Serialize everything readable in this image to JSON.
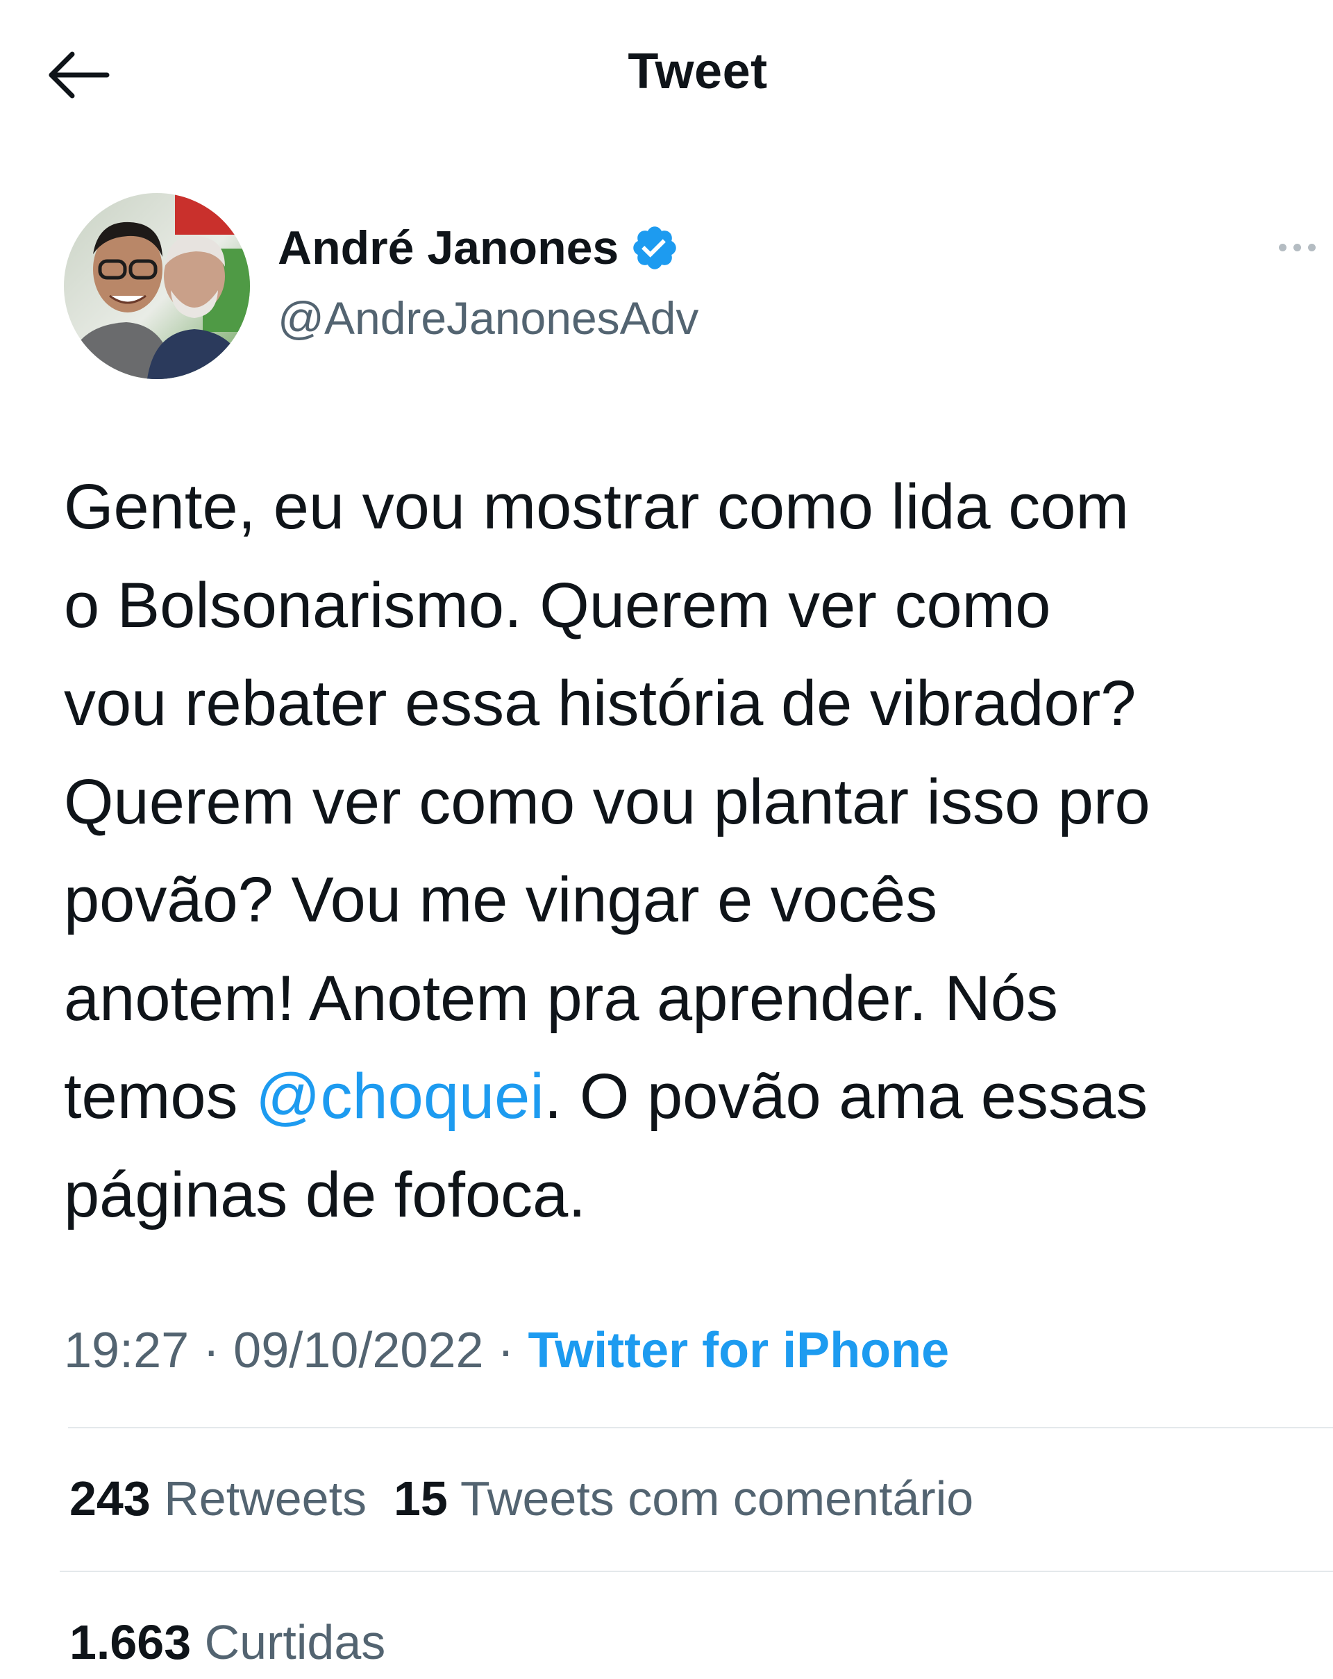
{
  "header": {
    "title": "Tweet"
  },
  "author": {
    "name": "André Janones",
    "handle": "@AndreJanonesAdv"
  },
  "tweet": {
    "lines": [
      "Gente, eu vou mostrar como lida com",
      "o Bolsonarismo. Querem ver como",
      "vou rebater essa história de vibrador?",
      "Querem ver como vou plantar isso pro",
      "povão? Vou me vingar e vocês",
      "anotem! Anotem pra aprender. Nós"
    ],
    "line7_prefix": "temos ",
    "mention": "@choquei",
    "line7_suffix": ". O povão ama essas",
    "line8": "páginas de fofoca."
  },
  "meta": {
    "time": "19:27",
    "date": "09/10/2022",
    "separator": " · ",
    "source": "Twitter for iPhone"
  },
  "stats": {
    "retweets_count": "243",
    "retweets_label": "Retweets",
    "quotes_count": "15",
    "quotes_label": "Tweets com comentário",
    "likes_count": "1.663",
    "likes_label": "Curtidas"
  },
  "colors": {
    "text": "#0f1419",
    "secondary": "#536471",
    "link": "#1d9bf0",
    "divider": "#e4e8eb"
  }
}
